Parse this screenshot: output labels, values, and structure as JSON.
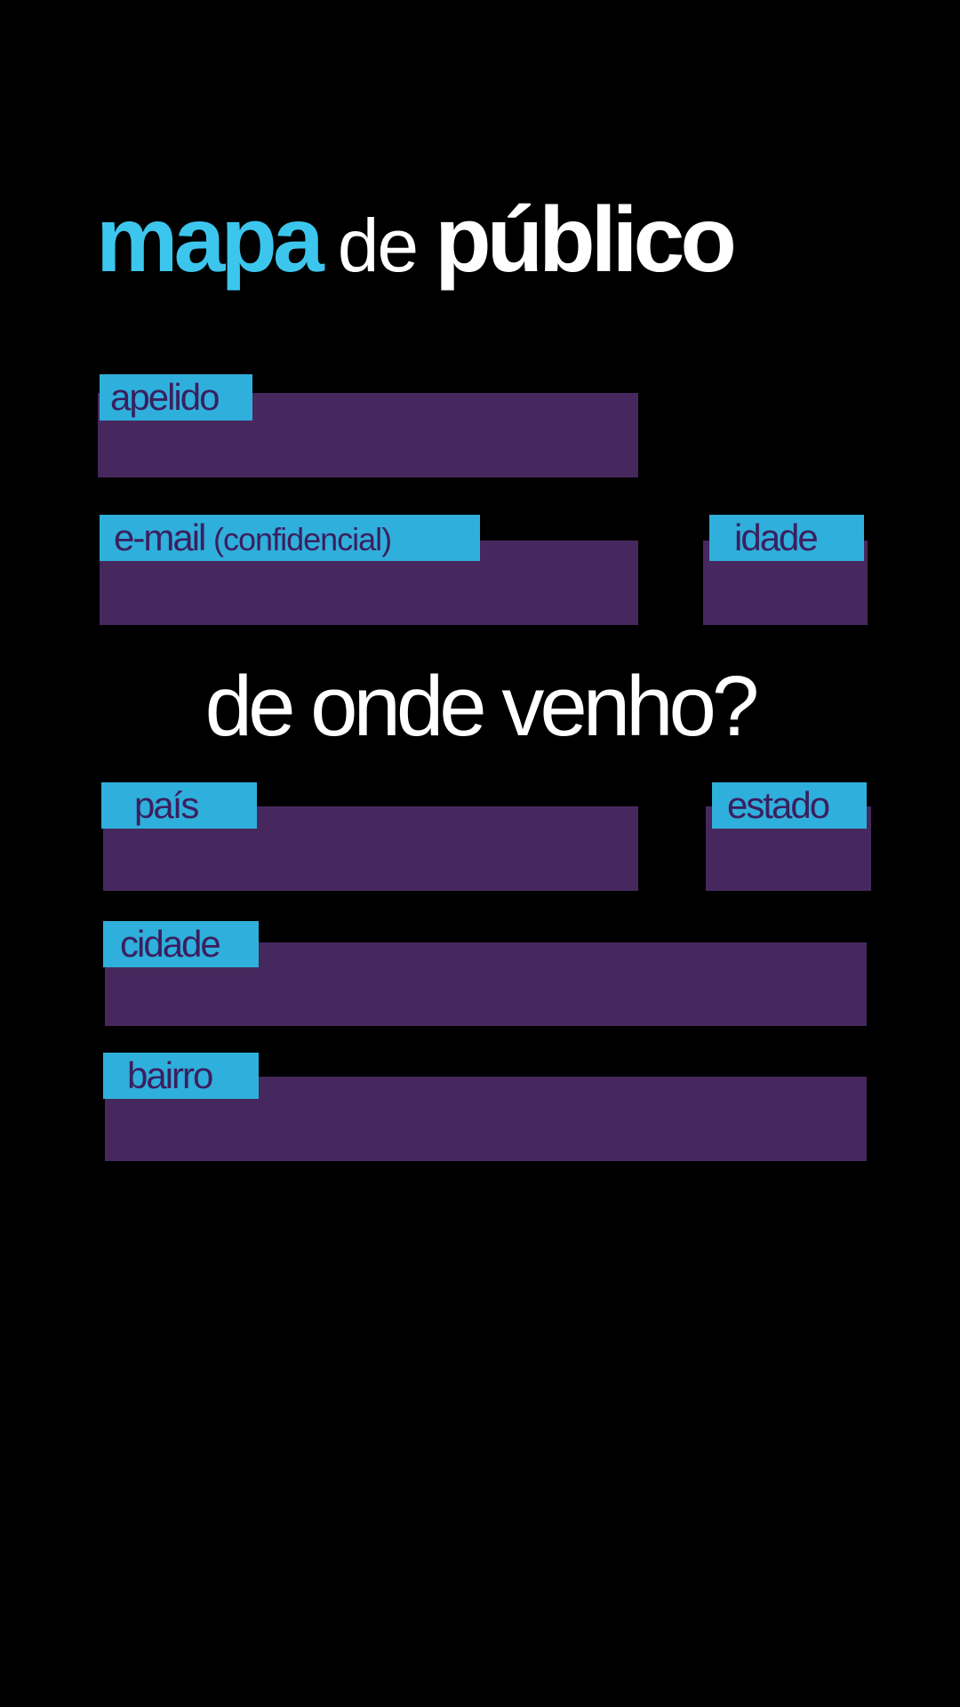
{
  "app": {
    "logo": {
      "part1": "mapa",
      "part2": "de",
      "part3": "público"
    }
  },
  "form": {
    "nickname": {
      "label": "apelido",
      "value": ""
    },
    "email": {
      "label_main": "e-mail",
      "label_note": "(confidencial)",
      "value": ""
    },
    "age": {
      "label": "idade",
      "value": ""
    },
    "origin_heading": "de onde venho?",
    "country": {
      "label": "país",
      "value": ""
    },
    "state": {
      "label": "estado",
      "value": ""
    },
    "city": {
      "label": "cidade",
      "value": ""
    },
    "neighborhood": {
      "label": "bairro",
      "value": ""
    }
  },
  "colors": {
    "background": "#000000",
    "accent_cyan": "#3cc6ee",
    "label_background": "#2fafdb",
    "label_text": "#3b1f5f",
    "input_background": "#46285e",
    "heading_text": "#ffffff"
  }
}
